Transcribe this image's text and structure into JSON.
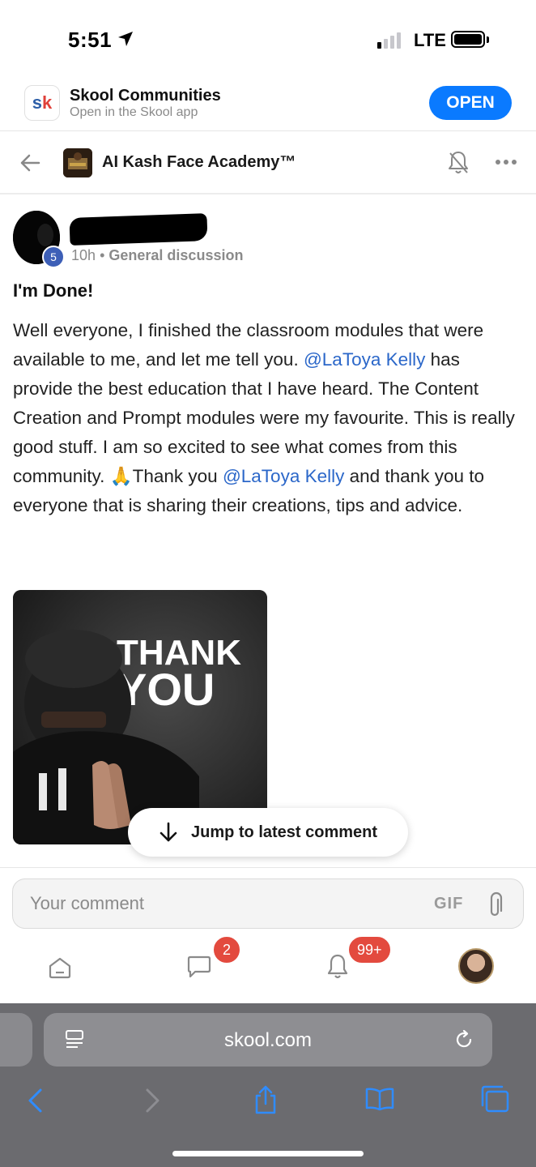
{
  "status_bar": {
    "time": "5:51",
    "network": "LTE"
  },
  "app_banner": {
    "logo_s": "s",
    "logo_k": "k",
    "title": "Skool Communities",
    "subtitle": "Open in the Skool app",
    "open_label": "OPEN"
  },
  "header": {
    "group_title": "AI Kash Face Academy™"
  },
  "post": {
    "level": "5",
    "age": "10h",
    "separator": "•",
    "category": "General discussion",
    "title": "I'm Done!",
    "body_1": "Well everyone, I finished the classroom modules that were available to me, and let me tell you. ",
    "mention_1": "@LaToya Kelly",
    "body_2": " has provide the best education that I have heard. The Content Creation and Prompt modules were my favourite. This is really good stuff. I am so excited to see what comes from this community. 🙏Thank you ",
    "mention_2": "@LaToya Kelly",
    "body_3": " and thank you to everyone that is sharing their creations, tips and advice.",
    "gif_text_1": "THANK",
    "gif_text_2": "YOU"
  },
  "jump_button": {
    "label": "Jump to latest comment"
  },
  "comment_bar": {
    "placeholder": "Your comment",
    "gif_label": "GIF"
  },
  "bottom_nav": {
    "chat_badge": "2",
    "notifications_badge": "99+"
  },
  "safari": {
    "url": "skool.com"
  },
  "colors": {
    "accent": "#0a7aff",
    "mention": "#2b67c9",
    "badge": "#e34a3e",
    "level_badge": "#3d5fb7"
  }
}
